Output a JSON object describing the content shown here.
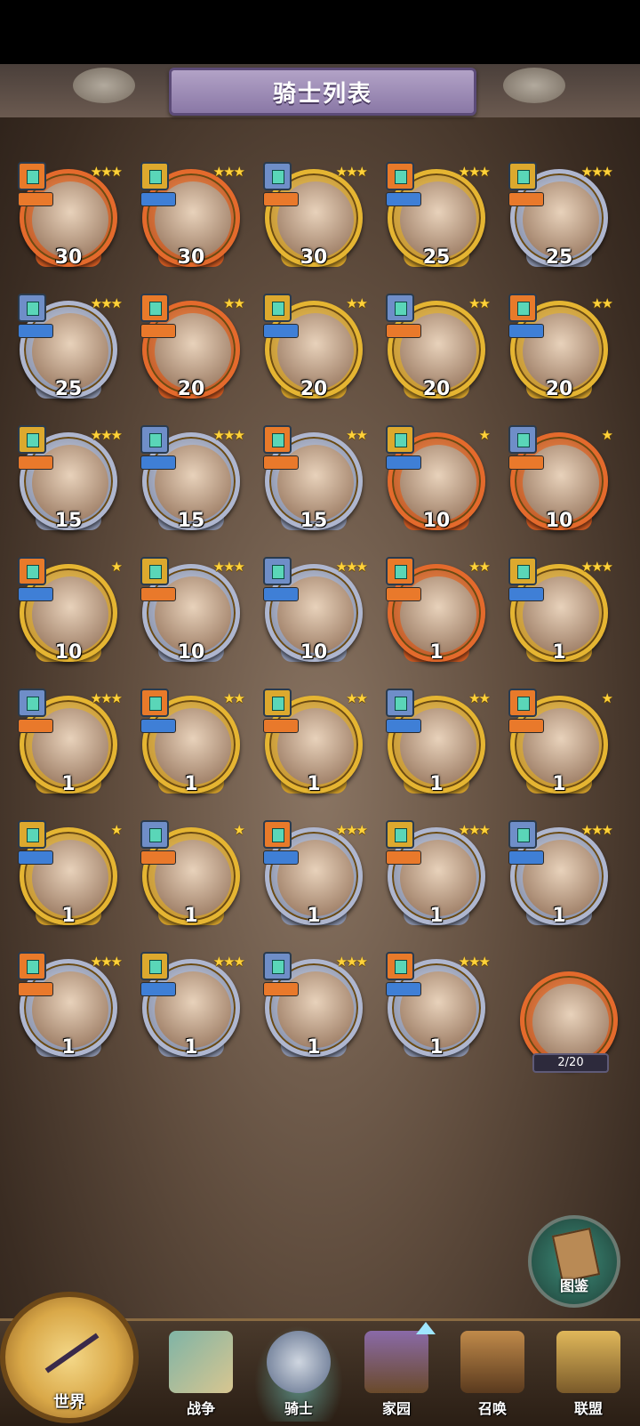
{
  "header": {
    "title": "骑士列表"
  },
  "cards": [
    {
      "level": "30",
      "stars": "★★★",
      "frame": "orange"
    },
    {
      "level": "30",
      "stars": "★★★",
      "frame": "orange"
    },
    {
      "level": "30",
      "stars": "★★★",
      "frame": "gold"
    },
    {
      "level": "25",
      "stars": "★★★",
      "frame": "gold"
    },
    {
      "level": "25",
      "stars": "★★★",
      "frame": "silver"
    },
    {
      "level": "25",
      "stars": "★★★",
      "frame": "silver"
    },
    {
      "level": "20",
      "stars": "★★",
      "frame": "orange"
    },
    {
      "level": "20",
      "stars": "★★",
      "frame": "gold"
    },
    {
      "level": "20",
      "stars": "★★",
      "frame": "gold"
    },
    {
      "level": "20",
      "stars": "★★",
      "frame": "gold"
    },
    {
      "level": "15",
      "stars": "★★★",
      "frame": "silver"
    },
    {
      "level": "15",
      "stars": "★★★",
      "frame": "silver"
    },
    {
      "level": "15",
      "stars": "★★",
      "frame": "silver"
    },
    {
      "level": "10",
      "stars": "★",
      "frame": "orange"
    },
    {
      "level": "10",
      "stars": "★",
      "frame": "orange"
    },
    {
      "level": "10",
      "stars": "★",
      "frame": "gold"
    },
    {
      "level": "10",
      "stars": "★★★",
      "frame": "silver"
    },
    {
      "level": "10",
      "stars": "★★★",
      "frame": "silver"
    },
    {
      "level": "1",
      "stars": "★★",
      "frame": "orange"
    },
    {
      "level": "1",
      "stars": "★★★",
      "frame": "gold"
    },
    {
      "level": "1",
      "stars": "★★★",
      "frame": "gold"
    },
    {
      "level": "1",
      "stars": "★★",
      "frame": "gold"
    },
    {
      "level": "1",
      "stars": "★★",
      "frame": "gold"
    },
    {
      "level": "1",
      "stars": "★★",
      "frame": "gold"
    },
    {
      "level": "1",
      "stars": "★",
      "frame": "gold"
    },
    {
      "level": "1",
      "stars": "★",
      "frame": "gold"
    },
    {
      "level": "1",
      "stars": "★",
      "frame": "gold"
    },
    {
      "level": "1",
      "stars": "★★★",
      "frame": "silver"
    },
    {
      "level": "1",
      "stars": "★★★",
      "frame": "silver"
    },
    {
      "level": "1",
      "stars": "★★★",
      "frame": "silver"
    },
    {
      "level": "1",
      "stars": "★★★",
      "frame": "silver"
    },
    {
      "level": "1",
      "stars": "★★★",
      "frame": "silver"
    },
    {
      "level": "1",
      "stars": "★★★",
      "frame": "silver"
    },
    {
      "level": "1",
      "stars": "★★★",
      "frame": "silver"
    }
  ],
  "special_card": {
    "fragments": "2/20"
  },
  "codex": {
    "label": "图鉴",
    "icon": "book-icon"
  },
  "nav": [
    {
      "label": "世界",
      "icon": "compass-icon"
    },
    {
      "label": "战争",
      "icon": "map-icon"
    },
    {
      "label": "骑士",
      "icon": "knight-icon",
      "active": true
    },
    {
      "label": "家园",
      "icon": "house-icon"
    },
    {
      "label": "召唤",
      "icon": "train-icon"
    },
    {
      "label": "联盟",
      "icon": "chest-icon"
    }
  ]
}
